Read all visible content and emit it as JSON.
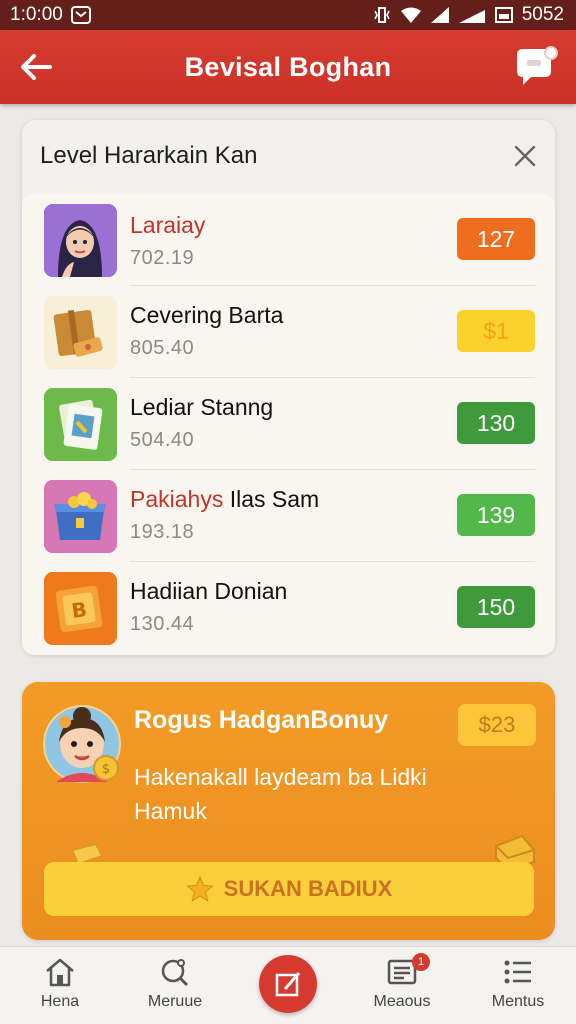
{
  "status_bar": {
    "time": "1:0:00",
    "battery_text": "5052",
    "icons": [
      "message-icon",
      "vibrate-icon",
      "wifi-icon",
      "signal-icon",
      "battery-icon"
    ]
  },
  "app_bar": {
    "title": "Bevisal Boghan",
    "back_icon": "back-arrow-icon",
    "chat_icon": "chat-bubble-icon",
    "color": "#d63a2f"
  },
  "level_card": {
    "title": "Level Hararkain Kan",
    "close_icon": "close-icon",
    "items": [
      {
        "name": "Laraiay",
        "sub": "702.19",
        "badge": "127",
        "badge_color": "#ef6d1f",
        "name_color": "#c2342a",
        "icon": "avatar-girl-icon"
      },
      {
        "name": "Cevering Barta",
        "sub": "805.40",
        "badge": "$1",
        "badge_color": "#fbd22c",
        "name_color": "#111111",
        "icon": "package-icon"
      },
      {
        "name": "Lediar Stanng",
        "sub": "504.40",
        "badge": "130",
        "badge_color": "#3f9a3c",
        "name_color": "#111111",
        "icon": "card-stack-icon"
      },
      {
        "name": "Pakiahys",
        "name_extra": " Ilas Sam",
        "sub": "193.18",
        "badge": "139",
        "badge_color": "#52b84a",
        "name_color": "#c2342a",
        "icon": "treasure-box-icon"
      },
      {
        "name": "Hadiian Donian",
        "sub": "130.44",
        "badge": "150",
        "badge_color": "#3f9a3c",
        "name_color": "#111111",
        "icon": "gold-block-icon"
      }
    ]
  },
  "bonus_card": {
    "title": "Rogus HadganBonuy",
    "price": "$23",
    "description": "Hakenakall laydeam ba Lidki Hamuk",
    "button_label": "SUKAN BADIUX",
    "button_icon": "star-icon",
    "avatar_icon": "avatar-girl-coin-icon",
    "color": "#f0951f"
  },
  "bottom_nav": {
    "items": [
      {
        "label": "Hena",
        "icon": "home-icon"
      },
      {
        "label": "Meruue",
        "icon": "search-icon"
      },
      {
        "label": "",
        "icon": "edit-icon"
      },
      {
        "label": "Meaous",
        "icon": "news-icon",
        "badge": "1"
      },
      {
        "label": "Mentus",
        "icon": "menu-icon"
      }
    ]
  }
}
